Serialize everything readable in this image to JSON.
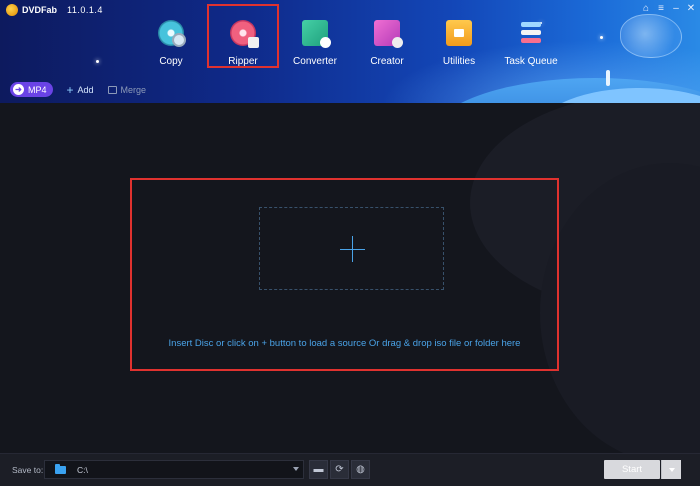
{
  "app": {
    "logo_text": "DVDFab",
    "version": "11.0.1.4"
  },
  "window_controls": [
    {
      "name": "home-icon",
      "glyph": "⌂"
    },
    {
      "name": "menu-icon",
      "glyph": "≡"
    },
    {
      "name": "minimize-icon",
      "glyph": "–"
    },
    {
      "name": "close-icon",
      "glyph": "✕"
    }
  ],
  "modules": [
    {
      "label": "Copy",
      "icon": "copy-disc-icon"
    },
    {
      "label": "Ripper",
      "icon": "ripper-disc-icon",
      "active": true
    },
    {
      "label": "Converter",
      "icon": "converter-film-icon"
    },
    {
      "label": "Creator",
      "icon": "creator-film-icon"
    },
    {
      "label": "Utilities",
      "icon": "utilities-folder-icon"
    },
    {
      "label": "Task Queue",
      "icon": "task-queue-icon"
    }
  ],
  "toolbar": {
    "profile_label": "MP4",
    "add_label": "Add",
    "merge_label": "Merge"
  },
  "drop_zone": {
    "hint": "Insert Disc or click on + button to load a source Or drag & drop iso file or folder here"
  },
  "footer": {
    "save_to_label": "Save to:",
    "path_value": "C:\\",
    "start_label": "Start"
  },
  "colors": {
    "highlight": "#e0322f",
    "accent": "#4aa3e8",
    "profile_badge": "#6a43e6"
  }
}
